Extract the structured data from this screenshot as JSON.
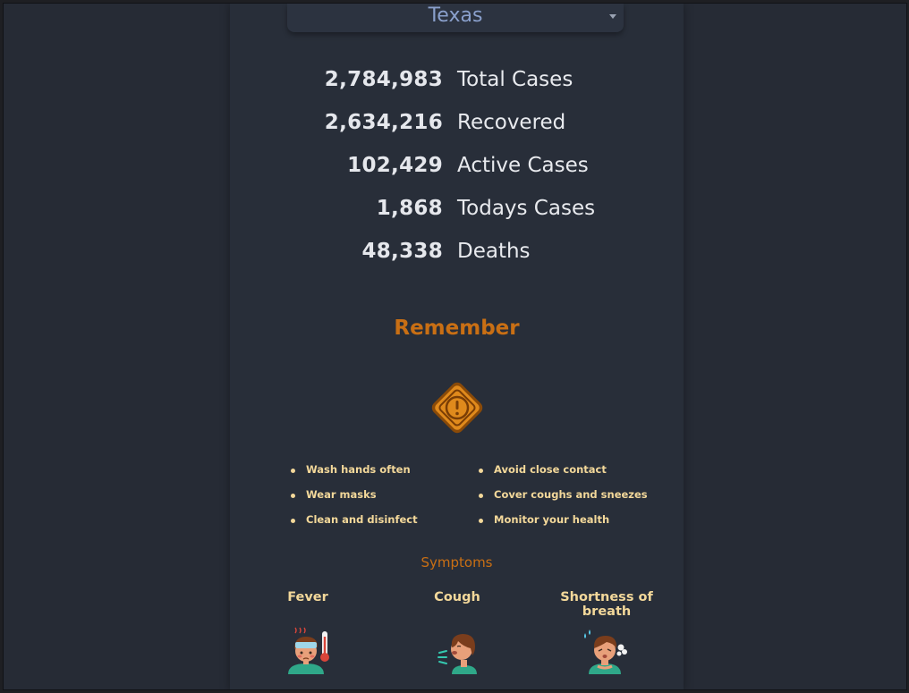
{
  "state_selector": {
    "selected": "Texas"
  },
  "stats": [
    {
      "value": "2,784,983",
      "label": "Total Cases"
    },
    {
      "value": "2,634,216",
      "label": "Recovered"
    },
    {
      "value": "102,429",
      "label": "Active Cases"
    },
    {
      "value": "1,868",
      "label": "Todays Cases"
    },
    {
      "value": "48,338",
      "label": "Deaths"
    }
  ],
  "remember": {
    "title": "Remember",
    "icon": "warning-icon",
    "tips_left": [
      "Wash hands often",
      "Wear masks",
      "Clean and disinfect"
    ],
    "tips_right": [
      "Avoid close contact",
      "Cover coughs and sneezes",
      "Monitor your health"
    ]
  },
  "symptoms": {
    "title": "Symptoms",
    "items": [
      {
        "name": "Fever",
        "icon": "fever-icon"
      },
      {
        "name": "Cough",
        "icon": "cough-icon"
      },
      {
        "name": "Shortness of breath",
        "icon": "shortness-of-breath-icon"
      }
    ]
  },
  "colors": {
    "accent": "#c96f14",
    "tip_text": "#f3d89a",
    "selector_text": "#8aa0cc"
  }
}
